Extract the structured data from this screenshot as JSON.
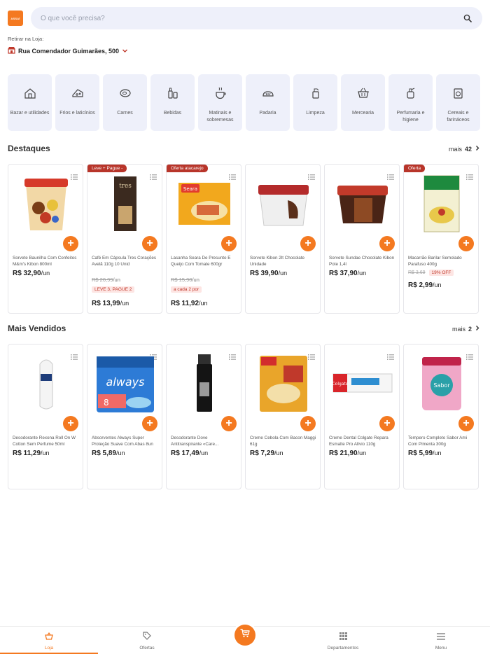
{
  "header": {
    "logo_text": "ASSAÍ",
    "search_placeholder": "O que você precisa?",
    "pickup_label": "Retirar na Loja:",
    "pickup_address": "Rua Comendador Guimarães, 500"
  },
  "categories": [
    {
      "label": "Bazar e utilidades",
      "icon": "house-icon"
    },
    {
      "label": "Frios e laticínios",
      "icon": "cheese-icon"
    },
    {
      "label": "Carnes",
      "icon": "meat-icon"
    },
    {
      "label": "Bebidas",
      "icon": "bottles-icon"
    },
    {
      "label": "Matinais e sobremesas",
      "icon": "cup-icon"
    },
    {
      "label": "Padaria",
      "icon": "bread-icon"
    },
    {
      "label": "Limpeza",
      "icon": "cleaning-icon"
    },
    {
      "label": "Mercearia",
      "icon": "basket-icon"
    },
    {
      "label": "Perfumaria e higiene",
      "icon": "perfume-icon"
    },
    {
      "label": "Cereais e farináceos",
      "icon": "cereal-icon"
    }
  ],
  "destaques": {
    "title": "Destaques",
    "more_label": "mais",
    "more_count": "42",
    "products": [
      {
        "badge": "",
        "name": "Sorvete Baunilha Com Confeitos M&m's Kibon 800ml",
        "old_price": "",
        "tag": "",
        "price": "R$ 32,90",
        "unit": "/un",
        "img": "tub-red"
      },
      {
        "badge": "Leve + Pague -",
        "name": "Café Em Cápsula Tres Corações Avelã 110g 10 Unid",
        "old_price": "R$ 20,99",
        "old_unit": "/un",
        "tag": "LEVE 3, PAGUE 2",
        "price": "R$ 13,99",
        "unit": "/un",
        "img": "coffee-box"
      },
      {
        "badge": "Oferta atacarejo",
        "name": "Lasanha Seara De Presunto E Queijo Com Tomate 600gr",
        "old_price": "R$ 15,90",
        "old_unit": "/un",
        "tag": "a cada 2 por",
        "price": "R$ 11,92",
        "unit": "/un",
        "img": "lasagna"
      },
      {
        "badge": "",
        "name": "Sorvete Kibon 2lt Chocolate Unidade",
        "old_price": "",
        "tag": "",
        "price": "R$ 39,90",
        "unit": "/un",
        "img": "tub-white"
      },
      {
        "badge": "",
        "name": "Sorvete Sundae Chocolate Kibon Pote 1,4l",
        "old_price": "",
        "tag": "",
        "price": "R$ 37,90",
        "unit": "/un",
        "img": "tub-brown"
      },
      {
        "badge": "Oferta",
        "name": "Macarrão Barilar Semolado Parafuso 400g",
        "old_price": "R$ 3,69",
        "tag": "19% OFF",
        "price": "R$ 2,99",
        "unit": "/un",
        "img": "pasta",
        "inline_discount": true
      }
    ]
  },
  "mais_vendidos": {
    "title": "Mais Vendidos",
    "more_label": "mais",
    "more_count": "2",
    "products": [
      {
        "name": "Desodorante Rexona Roll On W Cotton Sem Perfume 50ml",
        "price": "R$ 11,29",
        "unit": "/un",
        "img": "rollon"
      },
      {
        "name": "Absorventes Always Super Proteção Suave Com Abas 8un",
        "price": "R$ 5,89",
        "unit": "/un",
        "img": "always"
      },
      {
        "name": "Desodorante Dove Antitranspirante «Care...",
        "price": "R$ 17,49",
        "unit": "/un",
        "img": "spray"
      },
      {
        "name": "Creme Cebola Com Bacon Maggi 61g",
        "price": "R$ 7,29",
        "unit": "/un",
        "img": "soup"
      },
      {
        "name": "Creme Dental Colgate Repara Esmalte Pro Alívio 110g",
        "price": "R$ 21,90",
        "unit": "/un",
        "img": "toothpaste"
      },
      {
        "name": "Tempero Completo Sabor Ami Com Pimenta 300g",
        "price": "R$ 5,99",
        "unit": "/un",
        "img": "seasoning"
      }
    ]
  },
  "bottom_nav": {
    "loja": "Loja",
    "ofertas": "Ofertas",
    "departamentos": "Departamentos",
    "menu": "Menu"
  },
  "colors": {
    "accent": "#f47920",
    "badge": "#b8352a",
    "surface": "#eef0fa"
  }
}
